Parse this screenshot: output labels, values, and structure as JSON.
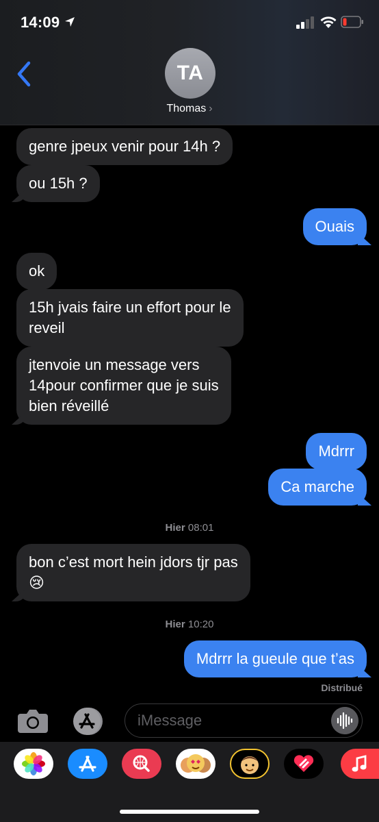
{
  "status_bar": {
    "time": "14:09",
    "battery_color": "#ff3b30"
  },
  "header": {
    "avatar_initials": "TA",
    "contact_name": "Thomas",
    "chevron": "›",
    "back_icon": "chevron-left-icon"
  },
  "messages": [
    {
      "text": "genre jpeux venir pour 14h ?"
    },
    {
      "text": "ou 15h ?"
    },
    {
      "text": "Ouais"
    },
    {
      "text": "ok"
    },
    {
      "text": "15h jvais faire un effort pour le\nreveil"
    },
    {
      "text": "jtenvoie un message vers\n14pour confirmer que je suis\nbien réveillé"
    },
    {
      "text": "Mdrrr"
    },
    {
      "text": "Ca marche"
    },
    {
      "text": "bon c’est mort hein jdors tjr pas\n😢"
    },
    {
      "text": "Mdrrr la gueule que t’as"
    }
  ],
  "timestamps": [
    {
      "day": "Hier",
      "time": "08:01"
    },
    {
      "day": "Hier",
      "time": "10:20"
    }
  ],
  "delivered": "Distribué",
  "input": {
    "placeholder": "iMessage"
  },
  "app_strip": [
    "photos-icon",
    "app-store-icon",
    "search-images-icon",
    "animoji-icon",
    "memoji-icon",
    "digital-touch-icon",
    "music-icon"
  ],
  "colors": {
    "outgoing": "#3b82f0",
    "incoming": "#262628",
    "accent": "#3478f6"
  }
}
